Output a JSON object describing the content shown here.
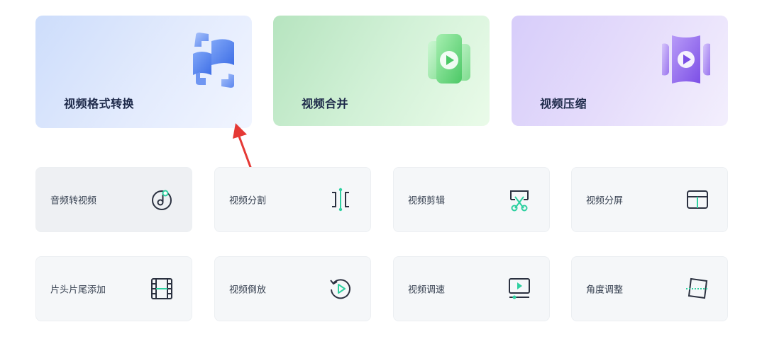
{
  "feature_cards": [
    {
      "label": "视频格式转换",
      "icon": "format-convert-icon"
    },
    {
      "label": "视频合并",
      "icon": "video-merge-icon"
    },
    {
      "label": "视频压缩",
      "icon": "video-compress-icon"
    }
  ],
  "tools_row1": [
    {
      "label": "音频转视频",
      "icon": "music-disc-icon"
    },
    {
      "label": "视频分割",
      "icon": "split-icon"
    },
    {
      "label": "视频剪辑",
      "icon": "scissors-icon"
    },
    {
      "label": "视频分屏",
      "icon": "split-screen-icon"
    }
  ],
  "tools_row2": [
    {
      "label": "片头片尾添加",
      "icon": "film-strip-icon"
    },
    {
      "label": "视频倒放",
      "icon": "reverse-play-icon"
    },
    {
      "label": "视频调速",
      "icon": "speed-monitor-icon"
    },
    {
      "label": "角度调整",
      "icon": "rotate-frame-icon"
    }
  ],
  "colors": {
    "accent_green": "#2ed0a0",
    "icon_dark": "#2b3140",
    "annotation_red": "#e53935"
  }
}
